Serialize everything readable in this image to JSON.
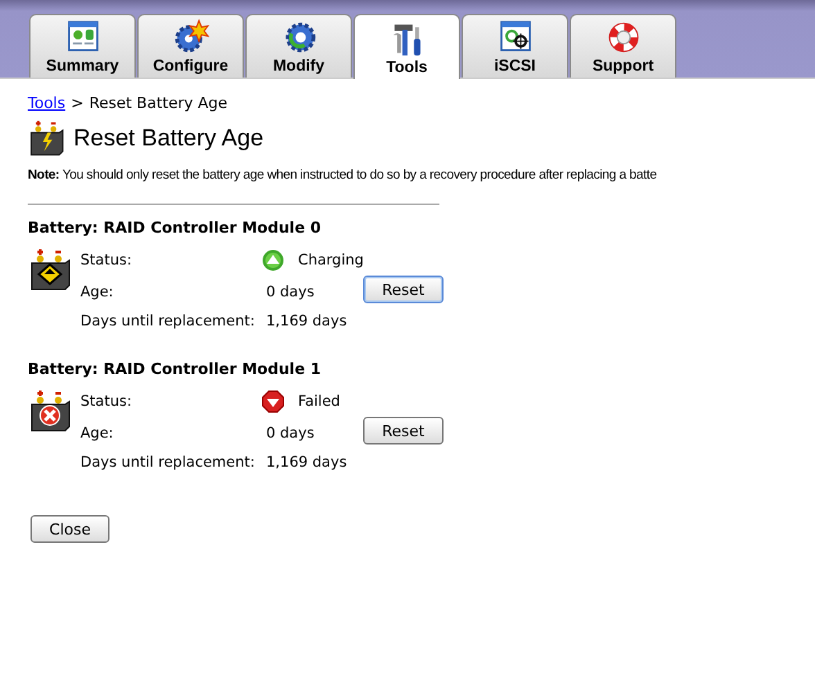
{
  "tabs": [
    {
      "label": "Summary",
      "kind": "summary",
      "selected": false
    },
    {
      "label": "Configure",
      "kind": "configure",
      "selected": false
    },
    {
      "label": "Modify",
      "kind": "modify",
      "selected": false
    },
    {
      "label": "Tools",
      "kind": "tools",
      "selected": true
    },
    {
      "label": "iSCSI",
      "kind": "iscsi",
      "selected": false
    },
    {
      "label": "Support",
      "kind": "support",
      "selected": false
    }
  ],
  "breadcrumb": {
    "link": "Tools",
    "separator": ">",
    "current": "Reset Battery Age"
  },
  "page_title": "Reset Battery Age",
  "note": "**Note:** You should only reset the battery age when instructed to do so by a recovery procedure after replacing a batte",
  "batteries": [
    {
      "title": "Battery: RAID Controller Module 0",
      "kind": "ok",
      "status_label": "Status:",
      "status": "Charging",
      "age_label": "Age:",
      "age": "0 days",
      "days_label": "Days until replacement:",
      "days": "1,169 days",
      "button": "Reset",
      "focused": true
    },
    {
      "title": "Battery: RAID Controller Module 1",
      "kind": "failed",
      "status_label": "Status:",
      "status": "Failed",
      "age_label": "Age:",
      "age": "0 days",
      "days_label": "Days until replacement:",
      "days": "1,169 days",
      "button": "Reset",
      "focused": false
    }
  ],
  "close_button": "Close"
}
